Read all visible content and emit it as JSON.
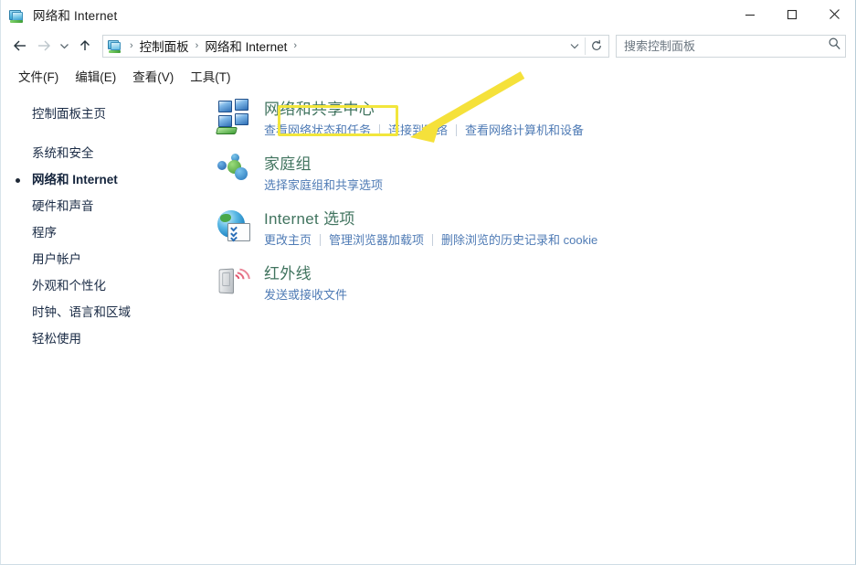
{
  "window": {
    "title": "网络和 Internet",
    "icon": "network-folder-icon",
    "controls": {
      "minimize": "minimize-button",
      "maximize": "maximize-button",
      "close": "close-button"
    }
  },
  "nav": {
    "back": "后退",
    "forward": "前进",
    "recent": "最近浏览的位置",
    "up": "向上"
  },
  "breadcrumb": {
    "items": [
      "控制面板",
      "网络和 Internet"
    ],
    "separator": "›",
    "trailing_separator": "›"
  },
  "address_actions": {
    "dropdown": "v",
    "refresh": "刷新"
  },
  "search": {
    "placeholder": "搜索控制面板",
    "value": "",
    "icon": "search-icon"
  },
  "menubar": {
    "items": [
      "文件(F)",
      "编辑(E)",
      "查看(V)",
      "工具(T)"
    ]
  },
  "sidebar": {
    "home": "控制面板主页",
    "items": [
      {
        "label": "系统和安全",
        "active": false
      },
      {
        "label": "网络和 Internet",
        "active": true
      },
      {
        "label": "硬件和声音",
        "active": false
      },
      {
        "label": "程序",
        "active": false
      },
      {
        "label": "用户帐户",
        "active": false
      },
      {
        "label": "外观和个性化",
        "active": false
      },
      {
        "label": "时钟、语言和区域",
        "active": false
      },
      {
        "label": "轻松使用",
        "active": false
      }
    ]
  },
  "main": {
    "categories": [
      {
        "title": "网络和共享中心",
        "icon": "network-sharing-center-icon",
        "highlighted": true,
        "links": [
          "查看网络状态和任务",
          "连接到网络",
          "查看网络计算机和设备"
        ]
      },
      {
        "title": "家庭组",
        "icon": "homegroup-icon",
        "highlighted": false,
        "links": [
          "选择家庭组和共享选项"
        ]
      },
      {
        "title": "Internet 选项",
        "icon": "internet-options-icon",
        "highlighted": false,
        "links": [
          "更改主页",
          "管理浏览器加载项",
          "删除浏览的历史记录和 cookie"
        ]
      },
      {
        "title": "红外线",
        "icon": "infrared-icon",
        "highlighted": false,
        "links": [
          "发送或接收文件"
        ]
      }
    ]
  },
  "annotations": {
    "highlight_color": "#f2e63c",
    "arrow_color": "#f5e13a",
    "target": "网络和共享中心"
  },
  "colors": {
    "category_title": "#41745f",
    "link": "#4f7bb5",
    "sidebar_text": "#1a2b45",
    "highlight": "#f2e63c"
  }
}
